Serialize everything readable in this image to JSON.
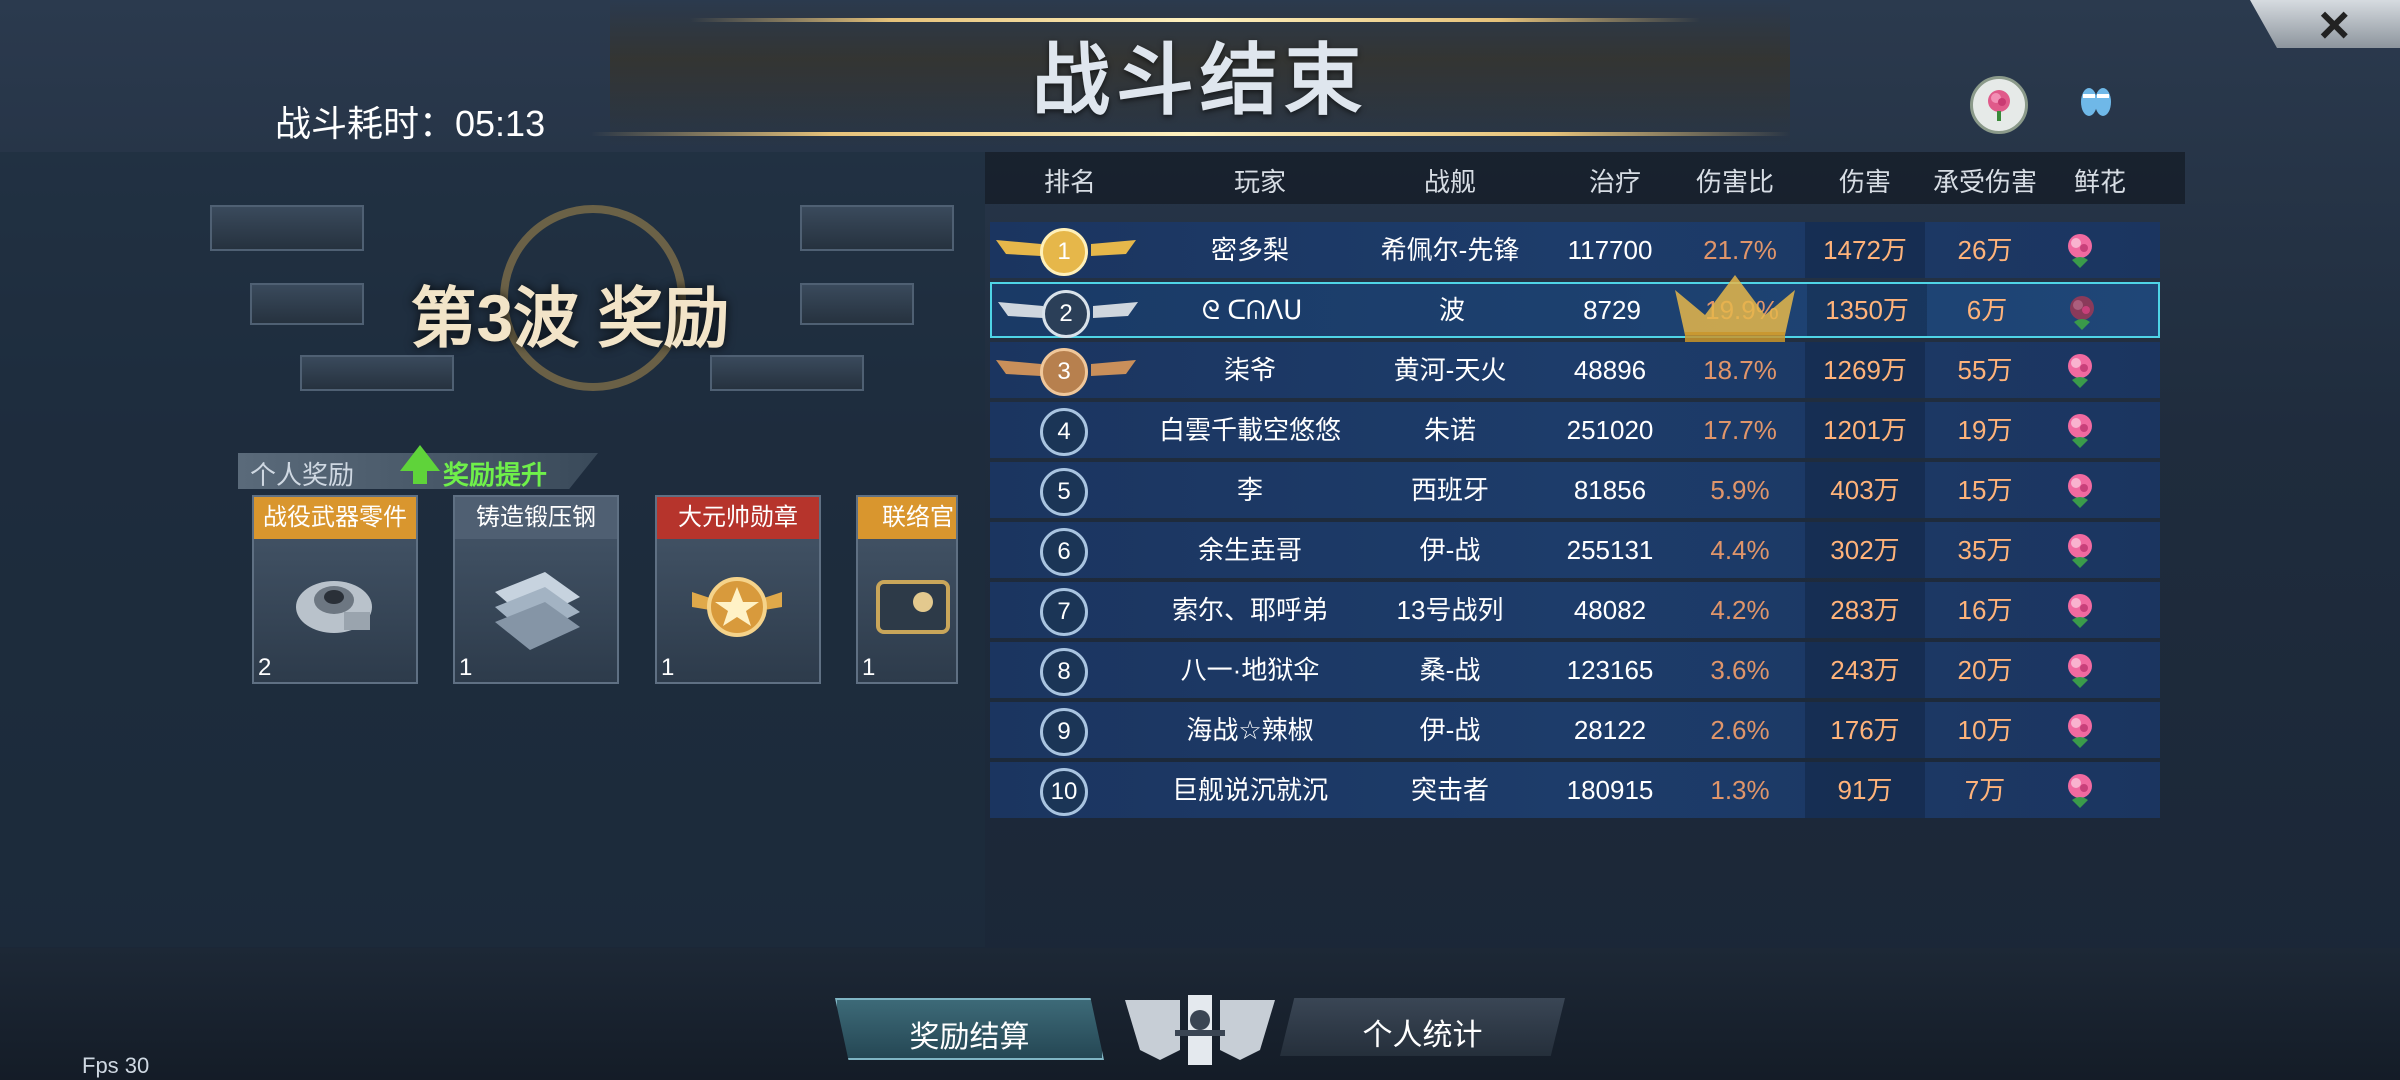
{
  "title": "战斗结束",
  "battle_time": "战斗耗时：05:13",
  "close_icon": "×",
  "top_icons": [
    "rose-icon",
    "slippers-icon"
  ],
  "wave": {
    "title": "第3波 奖励",
    "tab_label": "个人奖励",
    "upgrade_label": "奖励提升",
    "items": [
      {
        "name": "战役武器零件",
        "qty": "2",
        "header_color": "#d9962e"
      },
      {
        "name": "铸造锻压钢",
        "qty": "1",
        "header_color": "#4f5f72"
      },
      {
        "name": "大元帅勋章",
        "qty": "1",
        "header_color": "#b6342c"
      },
      {
        "name": "联络官",
        "qty": "1",
        "header_color": "#d9962e"
      }
    ]
  },
  "table": {
    "headers": [
      "排名",
      "玩家",
      "战舰",
      "治疗",
      "伤害比",
      "伤害",
      "承受伤害",
      "鲜花"
    ],
    "rows": [
      {
        "rank": "1",
        "player": "密多梨",
        "ship": "希佩尔-先锋",
        "heal": "117700",
        "ratio": "21.7%",
        "damage": "1472万",
        "taken": "26万"
      },
      {
        "rank": "2",
        "player": "ᘓ ᑕᕬᐱᑌ",
        "ship": "波",
        "heal": "8729",
        "ratio": "19.9%",
        "damage": "1350万",
        "taken": "6万"
      },
      {
        "rank": "3",
        "player": "柒爷",
        "ship": "黄河-天火",
        "heal": "48896",
        "ratio": "18.7%",
        "damage": "1269万",
        "taken": "55万"
      },
      {
        "rank": "4",
        "player": "白雲千載空悠悠",
        "ship": "朱诺",
        "heal": "251020",
        "ratio": "17.7%",
        "damage": "1201万",
        "taken": "19万"
      },
      {
        "rank": "5",
        "player": "李",
        "ship": "西班牙",
        "heal": "81856",
        "ratio": "5.9%",
        "damage": "403万",
        "taken": "15万"
      },
      {
        "rank": "6",
        "player": "余生垚哥",
        "ship": "伊-战",
        "heal": "255131",
        "ratio": "4.4%",
        "damage": "302万",
        "taken": "35万"
      },
      {
        "rank": "7",
        "player": "索尔、耶呼弟",
        "ship": "13号战列",
        "heal": "48082",
        "ratio": "4.2%",
        "damage": "283万",
        "taken": "16万"
      },
      {
        "rank": "8",
        "player": "八一·地狱伞",
        "ship": "桑-战",
        "heal": "123165",
        "ratio": "3.6%",
        "damage": "243万",
        "taken": "20万"
      },
      {
        "rank": "9",
        "player": "海战☆辣椒",
        "ship": "伊-战",
        "heal": "28122",
        "ratio": "2.6%",
        "damage": "176万",
        "taken": "10万"
      },
      {
        "rank": "10",
        "player": "巨舰说沉就沉",
        "ship": "突击者",
        "heal": "180915",
        "ratio": "1.3%",
        "damage": "91万",
        "taken": "7万"
      }
    ]
  },
  "bottom": {
    "reward_button": "奖励结算",
    "personal_button": "个人统计",
    "fps": "Fps 30"
  },
  "colors": {
    "ratio_text": "#e0956a",
    "damage_text": "#ffb37a",
    "taken_text": "#ffb37a",
    "row_blue": "#1d3c6a",
    "highlight_border": "#4fd4e6",
    "gold": "#e6c27a"
  }
}
